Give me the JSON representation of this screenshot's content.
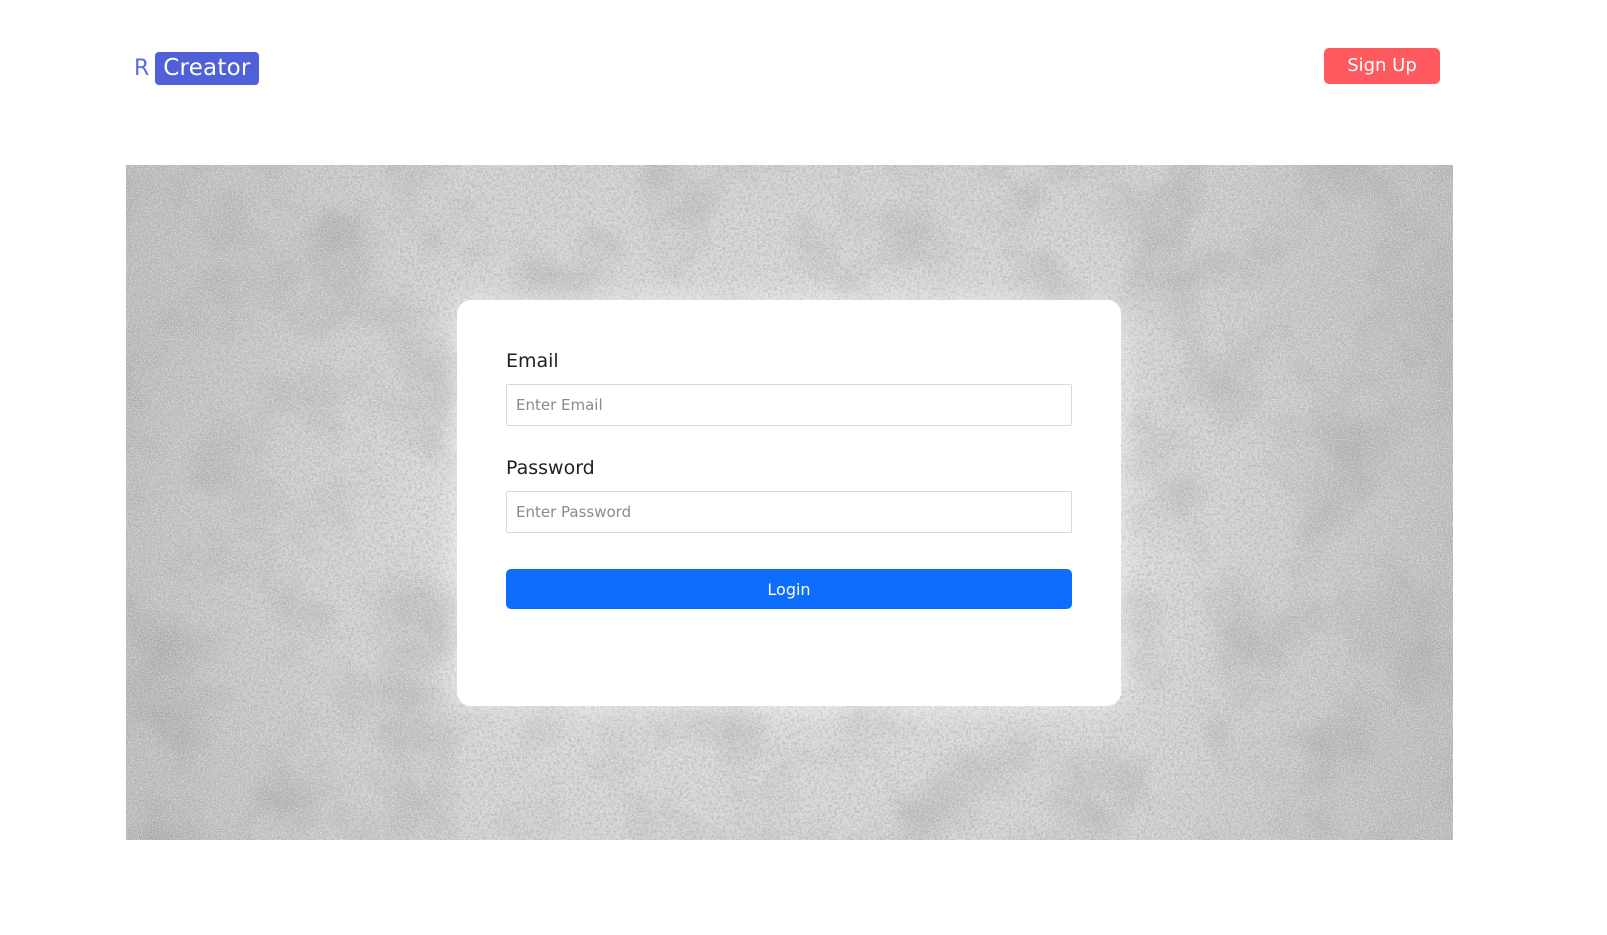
{
  "header": {
    "brand_letter": "R",
    "brand_name": "Creator",
    "signup_label": "Sign Up"
  },
  "login_form": {
    "email_label": "Email",
    "email_placeholder": "Enter Email",
    "email_value": "",
    "password_label": "Password",
    "password_placeholder": "Enter Password",
    "password_value": "",
    "submit_label": "Login"
  },
  "colors": {
    "brand_blue": "#4f60d9",
    "signup_red": "#ff5a5f",
    "login_blue": "#0d6efd",
    "background_gray": "#c9c9c9"
  }
}
